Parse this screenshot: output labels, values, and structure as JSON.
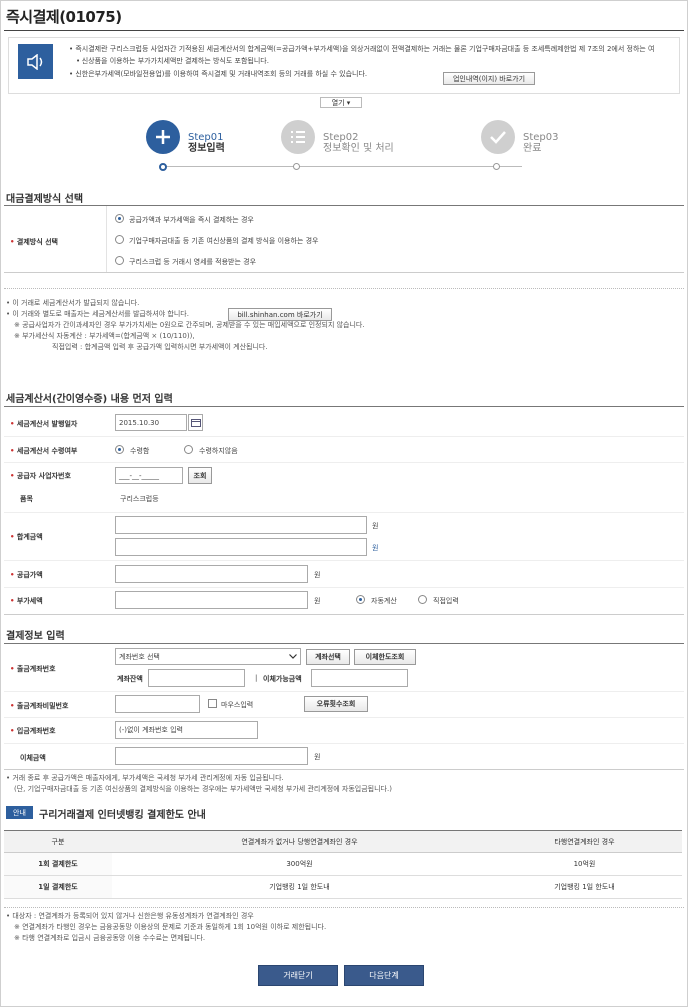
{
  "page": {
    "title": "즉시결제(01075)"
  },
  "notice": {
    "line1": "즉시결제란 구리스크럽등 사업자간 기적용된 세금계산서의 합계금액(=공급가액+부가세액)을 외상거래없이 전액결제하는 거래는 물론 기업구매자금대출 등 조세특례제한법 제 7조의 2에서 정하는 여",
    "line1b": "신상품을 이용하는 부가가치세액만 결제하는 방식도 포함됩니다.",
    "line2": "신한은부가세액(모바일전용업)를 이용하여 즉시결제 및 거래내역조회 등의 거래를 하실 수 있습니다.",
    "link_button": "업인내역(이지) 바로가기"
  },
  "open_button": "열기 ▾",
  "steps": [
    {
      "en": "Step01",
      "ko": "정보입력"
    },
    {
      "en": "Step02",
      "ko": "정보확인 및 처리"
    },
    {
      "en": "Step03",
      "ko": "완료"
    }
  ],
  "payment_method": {
    "section_title": "대금결제방식 선택",
    "label": "결제방식 선택",
    "options": [
      "공급가액과 부가세액을 즉시 결제하는 경우",
      "기업구매자금대출 등 기존 여신상품의 결제 방식을 이용하는 경우",
      "구리스크럽 등 거래시 영세를 적용받는 경우"
    ]
  },
  "info_notes": {
    "n1": "이 거래로 세금계산서가 발급되지 않습니다.",
    "n2": "이 거래와 별도로 매출자는 세금계산서를 발급하셔야 합니다.",
    "n2_button": "bill.shinhan.com 바로가기",
    "n3": "※ 공급사업자가 간이과세자인 경우 부가가치세는 0원으로 간주되며, 공제받을 수 있는 매입세액으로 인정되지 않습니다.",
    "n4": "※ 부가세산식 자동계산 : 부가세액=(합계금액 × (10/110)),",
    "n5": "직접입력 : 합계금액 입력 후 공급가액 입력하시면 부가세액이 계산됩니다."
  },
  "tax_invoice": {
    "section_title": "세금계산서(간이영수증) 내용 먼저 입력",
    "issue_date_label": "세금계산서 발행일자",
    "issue_date_value": "2015.10.30",
    "receive_label": "세금계산서 수령여부",
    "receive_yes": "수령함",
    "receive_no": "수령하지않음",
    "biz_no_label": "공급자 사업자번호",
    "biz_no_value": "___-__-_____",
    "lookup_button": "조회",
    "item_label": "품목",
    "item_value": "구리스크럽등",
    "total_label": "합계금액",
    "won": "원",
    "supply_label": "공급가액",
    "vat_label": "부가세액",
    "auto_calc": "자동계산",
    "manual_input": "직접입력"
  },
  "payment_info": {
    "section_title": "결제정보 입력",
    "out_account_label": "출금계좌번호",
    "out_account_select": "계좌번호 선택",
    "account_select_button": "계좌선택",
    "transfer_limit_button": "이체한도조회",
    "balance_label": "계좌잔액",
    "available_label": "이체가능금액",
    "password_label": "출금계좌비밀번호",
    "mouse_input": "마우스입력",
    "error_count_button": "오류횟수조회",
    "in_account_label": "입금계좌번호",
    "in_account_placeholder": "(-)없이 계좌번호 입력",
    "transfer_amount_label": "이체금액",
    "won": "원"
  },
  "payment_notes": {
    "n1": "거래 종료 후 공급가액은 매출자에게, 부가세액은 국세청 부가세 관리계정에 자동 입금됩니다.",
    "n2": "(단, 기업구매자금대출 등 기존 여신상품의 결제방식을 이용하는 경우에는 부가세액만 국세청 부가세 관리계정에 자동입금됩니다.)"
  },
  "limit": {
    "badge": "안내",
    "title": "구리거래결제 인터넷뱅킹 결제한도 안내",
    "headers": [
      "구분",
      "연결계좌가 없거나 당행연결계좌인 경우",
      "타행연결계좌인 경우"
    ],
    "rows": [
      [
        "1회 결제한도",
        "300억원",
        "10억원"
      ],
      [
        "1일 결제한도",
        "기업뱅킹 1일 한도내",
        "기업뱅킹 1일 한도내"
      ]
    ]
  },
  "bottom_notes": {
    "n1": "대상자 : 연결계좌가 등록되어 있지 않거나 신한은행 유동성계좌가 연결계좌인 경우",
    "n2": "※ 연결계좌가 타행인 경우는 금융공동망 이용상의 문제로 기준과 동일하게 1회 10억원 이하로 제한됩니다.",
    "n3": "※ 타행 연결계좌로 입금시 금융공동망 이용 수수료는 면제됩니다."
  },
  "buttons": {
    "cancel": "거래닫기",
    "next": "다음단계"
  },
  "colors": {
    "accent": "#2d5f9e",
    "step_active": "#2d5f9e",
    "step_inactive": "#cfcfcf"
  }
}
